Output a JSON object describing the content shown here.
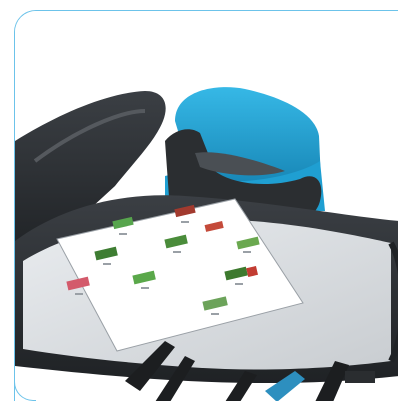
{
  "scene": {
    "subject": "",
    "accent_color": "#6cc3ea",
    "seat_color": "#1ea6d6",
    "tray_color": "#2f3236"
  },
  "card": {
    "grid": [
      [
        "",
        "",
        ""
      ],
      [
        "",
        "",
        ""
      ],
      [
        "",
        "",
        ""
      ]
    ]
  }
}
